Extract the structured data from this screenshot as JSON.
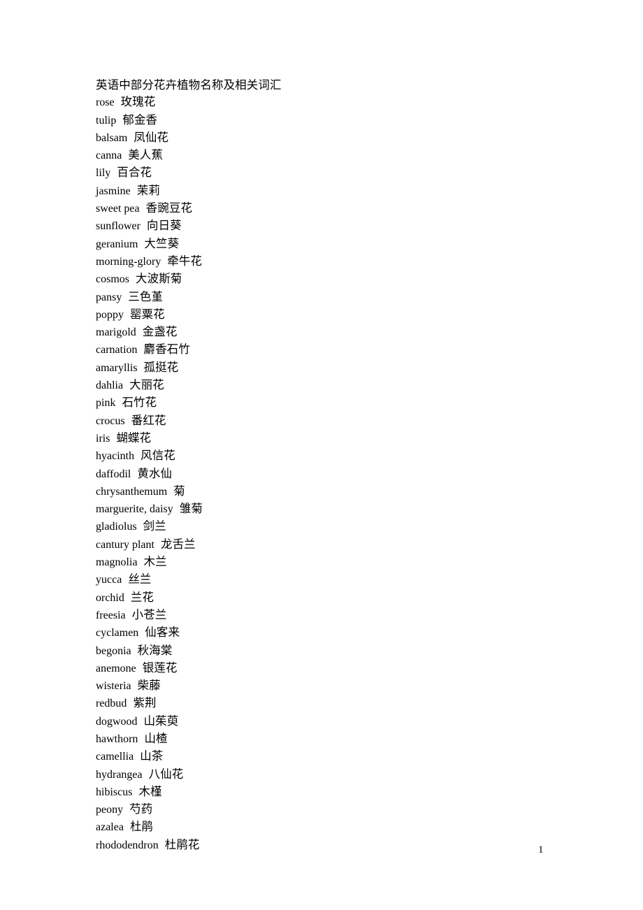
{
  "document": {
    "title": "英语中部分花卉植物名称及相关词汇",
    "page_number": "1",
    "entries": [
      {
        "en": "rose",
        "zh": "玫瑰花"
      },
      {
        "en": "tulip",
        "zh": "郁金香"
      },
      {
        "en": "balsam",
        "zh": "凤仙花"
      },
      {
        "en": "canna",
        "zh": "美人蕉"
      },
      {
        "en": "lily",
        "zh": "百合花"
      },
      {
        "en": "jasmine",
        "zh": "茉莉"
      },
      {
        "en": "sweet pea",
        "zh": "香豌豆花"
      },
      {
        "en": "sunflower",
        "zh": "向日葵"
      },
      {
        "en": "geranium",
        "zh": "大竺葵"
      },
      {
        "en": "morning-glory",
        "zh": "牵牛花"
      },
      {
        "en": "cosmos",
        "zh": "大波斯菊"
      },
      {
        "en": "pansy",
        "zh": "三色堇"
      },
      {
        "en": "poppy",
        "zh": "罂粟花"
      },
      {
        "en": "marigold",
        "zh": "金盏花"
      },
      {
        "en": "carnation",
        "zh": "麝香石竹"
      },
      {
        "en": "amaryllis",
        "zh": "孤挺花"
      },
      {
        "en": "dahlia",
        "zh": "大丽花"
      },
      {
        "en": "pink",
        "zh": "石竹花"
      },
      {
        "en": "crocus",
        "zh": "番红花"
      },
      {
        "en": "iris",
        "zh": "蝴蝶花"
      },
      {
        "en": "hyacinth",
        "zh": "风信花"
      },
      {
        "en": "daffodil",
        "zh": "黄水仙"
      },
      {
        "en": "chrysanthemum",
        "zh": "菊"
      },
      {
        "en": "marguerite, daisy",
        "zh": "雏菊"
      },
      {
        "en": "gladiolus",
        "zh": "剑兰"
      },
      {
        "en": "cantury plant",
        "zh": "龙舌兰"
      },
      {
        "en": "magnolia",
        "zh": "木兰"
      },
      {
        "en": "yucca",
        "zh": "丝兰"
      },
      {
        "en": "orchid",
        "zh": "兰花"
      },
      {
        "en": "freesia",
        "zh": "小苍兰"
      },
      {
        "en": "cyclamen",
        "zh": "仙客来"
      },
      {
        "en": "begonia",
        "zh": "秋海棠"
      },
      {
        "en": "anemone",
        "zh": "银莲花"
      },
      {
        "en": "wisteria",
        "zh": "柴藤"
      },
      {
        "en": "redbud",
        "zh": "紫荆"
      },
      {
        "en": "dogwood",
        "zh": "山茱萸"
      },
      {
        "en": "hawthorn",
        "zh": "山楂"
      },
      {
        "en": "camellia",
        "zh": "山茶"
      },
      {
        "en": "hydrangea",
        "zh": "八仙花"
      },
      {
        "en": "hibiscus",
        "zh": "木槿"
      },
      {
        "en": "peony",
        "zh": "芍药"
      },
      {
        "en": "azalea",
        "zh": "杜鹃"
      },
      {
        "en": "rhododendron",
        "zh": "杜鹃花"
      }
    ]
  }
}
